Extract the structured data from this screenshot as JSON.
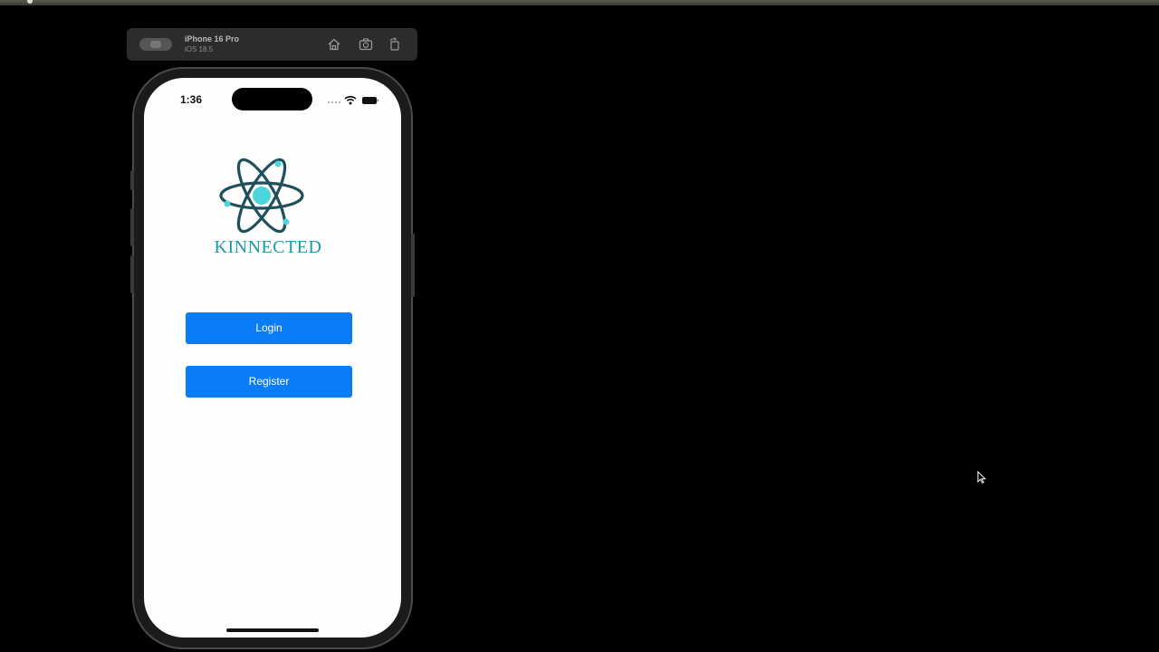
{
  "simulator": {
    "device_name": "iPhone 16 Pro",
    "os_version": "iOS 18.5"
  },
  "status_bar": {
    "time": "1:36"
  },
  "app": {
    "brand": "KINNECTED",
    "login_label": "Login",
    "register_label": "Register"
  },
  "colors": {
    "button": "#0a7cf5",
    "brand": "#1b9aa0",
    "logo_dark": "#1d4f5c",
    "logo_accent": "#4cd6dc"
  }
}
